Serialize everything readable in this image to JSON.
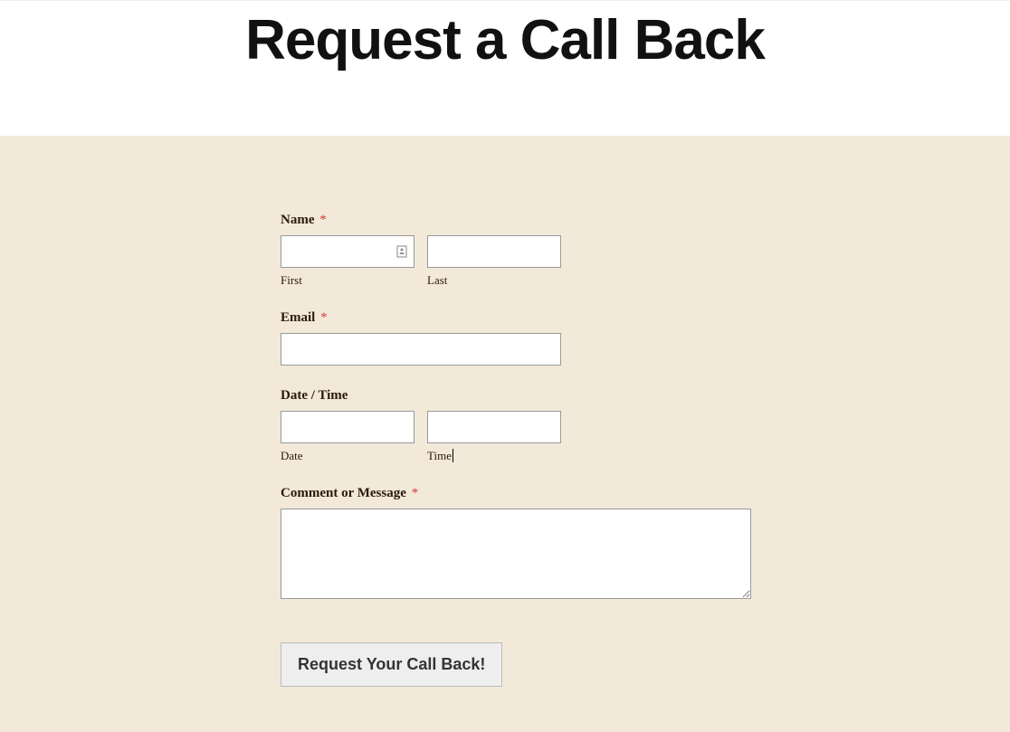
{
  "header": {
    "title": "Request a Call Back"
  },
  "form": {
    "name": {
      "label": "Name",
      "required": "*",
      "first_sublabel": "First",
      "last_sublabel": "Last",
      "first_value": "",
      "last_value": ""
    },
    "email": {
      "label": "Email",
      "required": "*",
      "value": ""
    },
    "datetime": {
      "label": "Date / Time",
      "date_sublabel": "Date",
      "time_sublabel": "Time",
      "date_value": "",
      "time_value": ""
    },
    "comment": {
      "label": "Comment or Message",
      "required": "*",
      "value": ""
    },
    "submit": {
      "label": "Request Your Call Back!"
    }
  }
}
